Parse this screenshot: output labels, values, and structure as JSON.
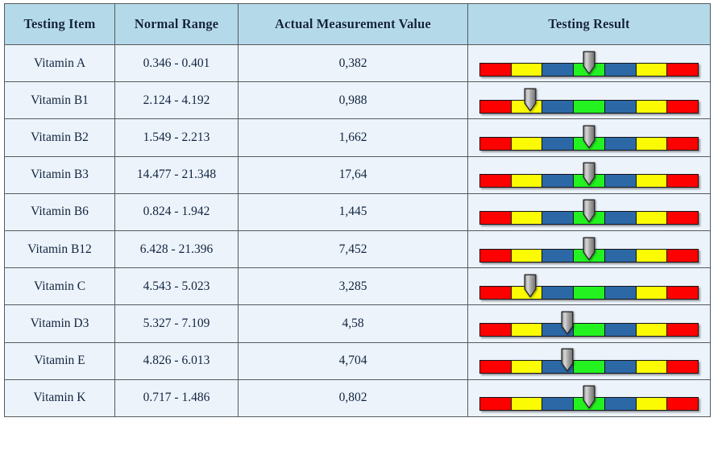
{
  "table": {
    "columns": [
      {
        "key": "item",
        "label": "Testing Item"
      },
      {
        "key": "range",
        "label": "Normal Range"
      },
      {
        "key": "value",
        "label": "Actual Measurement Value"
      },
      {
        "key": "result",
        "label": "Testing Result"
      }
    ],
    "rows": [
      {
        "item": "Vitamin A",
        "range": "0.346 - 0.401",
        "value": "0,382",
        "marker_percent": 50
      },
      {
        "item": "Vitamin B1",
        "range": "2.124 - 4.192",
        "value": "0,988",
        "marker_percent": 23
      },
      {
        "item": "Vitamin B2",
        "range": "1.549 - 2.213",
        "value": "1,662",
        "marker_percent": 50
      },
      {
        "item": "Vitamin B3",
        "range": "14.477 - 21.348",
        "value": "17,64",
        "marker_percent": 50
      },
      {
        "item": "Vitamin B6",
        "range": "0.824 - 1.942",
        "value": "1,445",
        "marker_percent": 50
      },
      {
        "item": "Vitamin B12",
        "range": "6.428 - 21.396",
        "value": "7,452",
        "marker_percent": 50
      },
      {
        "item": "Vitamin C",
        "range": "4.543 - 5.023",
        "value": "3,285",
        "marker_percent": 23
      },
      {
        "item": "Vitamin D3",
        "range": "5.327 - 7.109",
        "value": "4,58",
        "marker_percent": 40
      },
      {
        "item": "Vitamin E",
        "range": "4.826 - 6.013",
        "value": "4,704",
        "marker_percent": 40
      },
      {
        "item": "Vitamin K",
        "range": "0.717 - 1.486",
        "value": "0,802",
        "marker_percent": 50
      }
    ]
  },
  "gauge": {
    "segments": [
      "red",
      "yellow",
      "blue",
      "green",
      "blue",
      "yellow",
      "red"
    ],
    "segment_count": 7,
    "marker_icon": "pin-marker-icon",
    "colors": {
      "red": "#fe0000",
      "yellow": "#fbfb04",
      "blue": "#2c68a6",
      "green": "#23f220",
      "marker": "#9a9a9a",
      "border": "#12151a"
    }
  },
  "style": {
    "header_background": "#b4d9e9",
    "cell_background": "#edf3fb",
    "border_color": "#555a5e",
    "text_color": "#10243f"
  }
}
